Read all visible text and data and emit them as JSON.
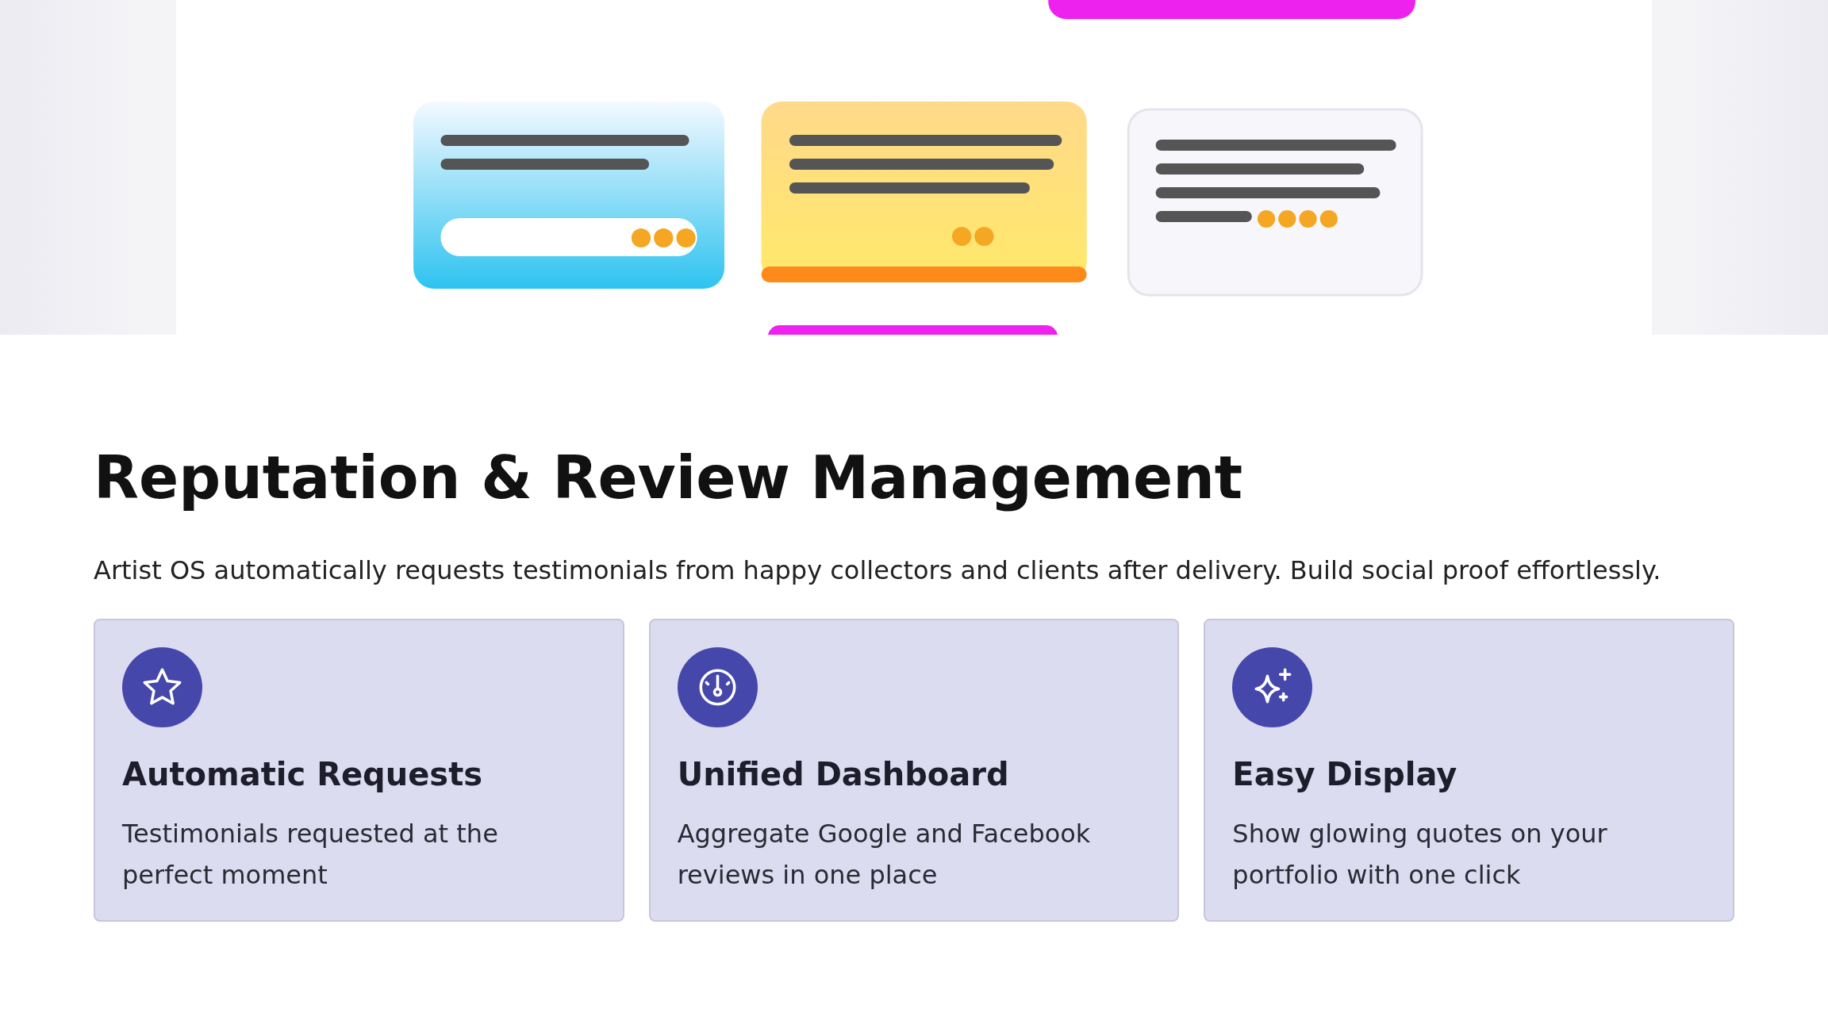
{
  "hero": {
    "kind": "illustration"
  },
  "section": {
    "title": "Reputation & Review Management",
    "description": "Artist OS automatically requests testimonials from happy collectors and clients after delivery. Build social proof effortlessly."
  },
  "features": [
    {
      "kind": "star",
      "title": "Automatic Requests",
      "text": "Testimonials requested at the perfect moment"
    },
    {
      "kind": "gauge",
      "title": "Unified Dashboard",
      "text": "Aggregate Google and Facebook reviews in one place"
    },
    {
      "kind": "sparkles",
      "title": "Easy Display",
      "text": "Show glowing quotes on your portfolio with one click"
    }
  ]
}
